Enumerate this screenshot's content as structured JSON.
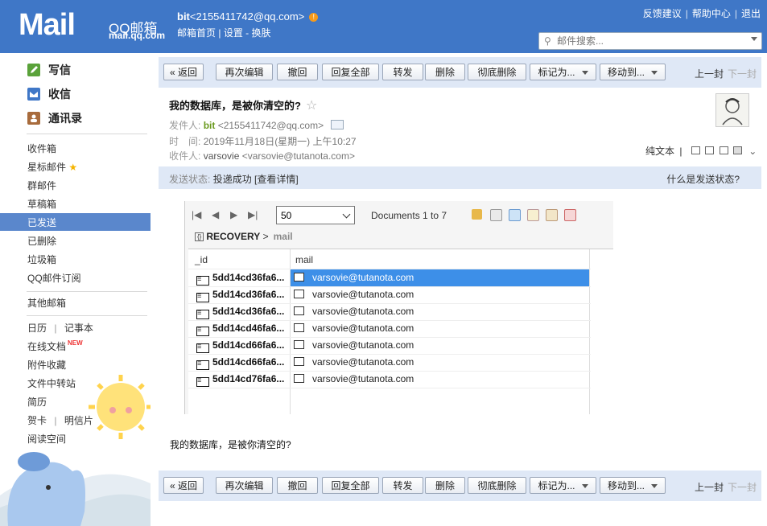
{
  "header": {
    "logo_text": "Mail",
    "brand": "QQ邮箱",
    "domain": "mail.qq.com",
    "account_name": "bit",
    "account_email": "<2155411742@qq.com>",
    "warn_icon": "!",
    "sub_links": [
      "邮箱首页",
      "设置",
      "换肤"
    ],
    "top_links": [
      "反馈建议",
      "帮助中心",
      "退出"
    ],
    "search_placeholder": "邮件搜索..."
  },
  "leftnav": {
    "compose": "写信",
    "inbox_main": "收信",
    "contacts": "通讯录",
    "folders": [
      "收件箱",
      "星标邮件",
      "群邮件",
      "草稿箱",
      "已发送",
      "已删除",
      "垃圾箱",
      "QQ邮件订阅"
    ],
    "selected_folder": "已发送",
    "other": "其他邮箱",
    "apps": [
      "日历",
      "记事本",
      "在线文档",
      "附件收藏",
      "文件中转站",
      "简历",
      "贺卡",
      "明信片",
      "阅读空间"
    ],
    "new_badge": "NEW",
    "sep": "|"
  },
  "toolbar": {
    "back": "« 返回",
    "reedit": "再次编辑",
    "recall": "撤回",
    "reply_all": "回复全部",
    "forward": "转发",
    "delete": "删除",
    "delete_forever": "彻底删除",
    "mark_as": "标记为...",
    "move_to": "移动到...",
    "prev": "上一封",
    "next": "下一封"
  },
  "message": {
    "subject": "我的数据库，是被你清空的?",
    "from_label": "发件人:",
    "from_name": "bit",
    "from_addr": "<2155411742@qq.com>",
    "time_label": "时　间:",
    "time_value": "2019年11月18日(星期一) 上午10:27",
    "to_label": "收件人:",
    "to_name": "varsovie",
    "to_addr": "<varsovie@tutanota.com>",
    "plain_text": "纯文本",
    "status_label": "发送状态:",
    "status_value": "投递成功 [查看详情]",
    "status_help": "什么是发送状态?",
    "body_text": "我的数据库，是被你清空的?"
  },
  "screenshot": {
    "page_size": "50",
    "documents": "Documents 1 to 7",
    "collection": "RECOVERY",
    "collection_sep": ">",
    "field": "mail",
    "columns": [
      "_id",
      "mail"
    ],
    "rows": [
      {
        "id": "5dd14cd36fa6...",
        "mail": "varsovie@tutanota.com"
      },
      {
        "id": "5dd14cd36fa6...",
        "mail": "varsovie@tutanota.com"
      },
      {
        "id": "5dd14cd36fa6...",
        "mail": "varsovie@tutanota.com"
      },
      {
        "id": "5dd14cd46fa6...",
        "mail": "varsovie@tutanota.com"
      },
      {
        "id": "5dd14cd66fa6...",
        "mail": "varsovie@tutanota.com"
      },
      {
        "id": "5dd14cd66fa6...",
        "mail": "varsovie@tutanota.com"
      },
      {
        "id": "5dd14cd76fa6...",
        "mail": "varsovie@tutanota.com"
      }
    ],
    "selected_row": 0
  },
  "icons": {
    "compose": "edit-icon",
    "inbox": "inbox-icon",
    "contacts": "contacts-icon",
    "search": "search-icon"
  },
  "colors": {
    "header_bg": "#3f77c7",
    "toolbar_bg": "#dfe8f6",
    "nav_selected": "#5a87cc",
    "selected_row": "#3d8fe8"
  }
}
